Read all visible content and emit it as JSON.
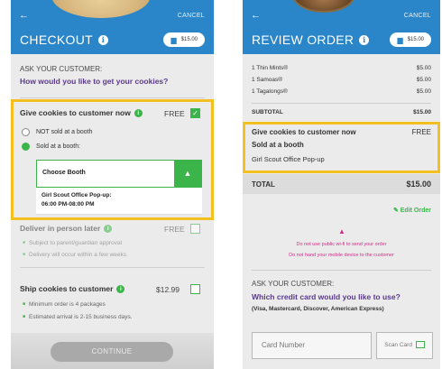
{
  "left": {
    "header": {
      "back": "←",
      "cancel": "CANCEL",
      "title": "CHECKOUT",
      "info": "i",
      "cart_total": "$15.00"
    },
    "ask_label": "ASK YOUR CUSTOMER:",
    "ask_question": "How would you like to get your cookies?",
    "option_now": {
      "title": "Give cookies to customer now",
      "price": "FREE",
      "checked": true
    },
    "radio_not_booth": "NOT sold at a booth",
    "radio_booth": "Sold at a booth:",
    "choose_booth": "Choose Booth",
    "booth_dropdown": {
      "name": "Girl Scout Office Pop-up:",
      "time": "06:00 PM-08:00 PM"
    },
    "option_later": {
      "title": "Deliver in person later",
      "price": "FREE"
    },
    "later_bullets": [
      "Subject to parent/guardian approval",
      "Delivery will occur within a few weeks."
    ],
    "option_ship": {
      "title": "Ship cookies to customer",
      "price": "$12.99"
    },
    "ship_bullets": [
      "Minimum order is 4 packages",
      "Estimated arrival is 2-15 business days."
    ],
    "continue": "CONTINUE"
  },
  "right": {
    "header": {
      "back": "←",
      "cancel": "CANCEL",
      "title": "REVIEW ORDER",
      "info": "i",
      "cart_total": "$15.00"
    },
    "items": [
      {
        "name": "1 Thin Mints®",
        "price": "$5.00"
      },
      {
        "name": "1 Samoas®",
        "price": "$5.00"
      },
      {
        "name": "1 Tagalongs®",
        "price": "$5.00"
      }
    ],
    "subtotal": {
      "label": "SUBTOTAL",
      "value": "$15.00"
    },
    "delivery": {
      "title": "Give cookies to customer now",
      "price": "FREE",
      "subtitle": "Sold at a booth",
      "booth": "Girl Scout Office Pop-up"
    },
    "total": {
      "label": "TOTAL",
      "value": "$15.00"
    },
    "edit_order": "Edit Order",
    "warnings": [
      "Do not use public wi-fi to send your order",
      "Do not hand your mobile device to the customer"
    ],
    "ask_label": "ASK YOUR CUSTOMER:",
    "ask_question": "Which credit card would you like to use?",
    "card_types": "(Visa, Mastercard, Discover, American Express)",
    "card_placeholder": "Card Number",
    "scan_card": "Scan Card"
  },
  "colors": {
    "header": "#2a86c8",
    "accent_green": "#3bb54a",
    "highlight": "#f4bf21",
    "warning": "#d22c8a",
    "question": "#5a3a8a"
  }
}
